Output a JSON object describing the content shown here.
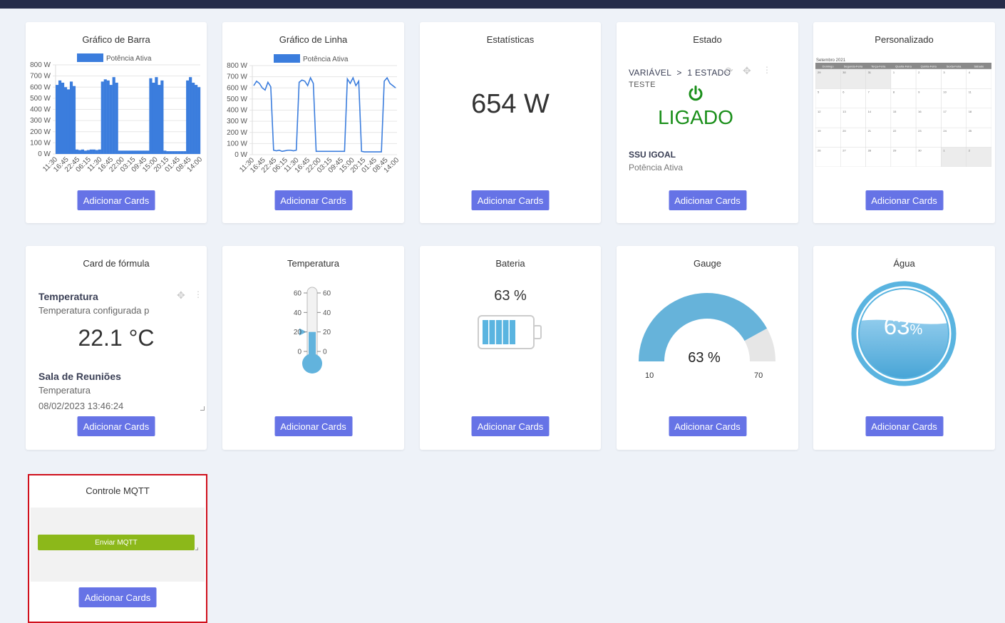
{
  "common": {
    "add_label": "Adicionar Cards"
  },
  "bar_card": {
    "title": "Gráfico de Barra",
    "chart_data": {
      "type": "bar",
      "legend": "Potência Ativa",
      "yticks": [
        "800 W",
        "700 W",
        "600 W",
        "500 W",
        "400 W",
        "300 W",
        "200 W",
        "100 W",
        "0 W"
      ],
      "xticks": [
        "11:30",
        "16:45",
        "22:45",
        "06:15",
        "11:30",
        "16:45",
        "22:00",
        "03:15",
        "09:45",
        "15:00",
        "20:15",
        "01:45",
        "08:45",
        "14:00"
      ],
      "ylim": [
        0,
        800
      ],
      "values": [
        620,
        660,
        640,
        600,
        580,
        650,
        610,
        40,
        35,
        40,
        30,
        35,
        40,
        40,
        35,
        40,
        650,
        670,
        660,
        620,
        690,
        640,
        30,
        30,
        30,
        30,
        30,
        30,
        30,
        30,
        30,
        30,
        30,
        680,
        640,
        690,
        620,
        660,
        30,
        25,
        25,
        25,
        25,
        25,
        25,
        25,
        660,
        690,
        640,
        620,
        600
      ]
    }
  },
  "line_card": {
    "title": "Gráfico de Linha",
    "chart_data": {
      "type": "line",
      "legend": "Potência Ativa",
      "yticks": [
        "800 W",
        "700 W",
        "600 W",
        "500 W",
        "400 W",
        "300 W",
        "200 W",
        "100 W",
        "0 W"
      ],
      "xticks": [
        "11:30",
        "16:45",
        "22:45",
        "06:15",
        "11:30",
        "16:45",
        "22:00",
        "03:15",
        "09:45",
        "15:00",
        "20:15",
        "01:45",
        "08:45",
        "14:00"
      ],
      "ylim": [
        0,
        800
      ],
      "values": [
        620,
        660,
        640,
        600,
        580,
        650,
        610,
        40,
        35,
        40,
        30,
        35,
        40,
        40,
        35,
        40,
        650,
        670,
        660,
        620,
        690,
        640,
        30,
        30,
        30,
        30,
        30,
        30,
        30,
        30,
        30,
        30,
        30,
        680,
        640,
        690,
        620,
        660,
        30,
        25,
        25,
        25,
        25,
        25,
        25,
        25,
        660,
        690,
        640,
        620,
        600
      ]
    }
  },
  "stats_card": {
    "title": "Estatísticas",
    "value": "654 W"
  },
  "estado_card": {
    "title": "Estado",
    "variable": "VARIÁVEL",
    "sep": ">",
    "state_name": "1 ESTADO",
    "tag": "TESTE",
    "state_value": "LIGADO",
    "device": "SSU IGOAL",
    "measure": "Potência Ativa",
    "state_color": "#1a8f1a"
  },
  "personalizado_card": {
    "title": "Personalizado",
    "calendar_title": "Setembro 2021",
    "weekdays": [
      "Domingo",
      "Segunda-Feira",
      "Terça-Feira",
      "Quarta-Feira",
      "Quinta-Feira",
      "Sexta-Feira",
      "Sábado"
    ],
    "weeks": [
      [
        "29",
        "30",
        "31",
        "1",
        "2",
        "3",
        "4"
      ],
      [
        "5",
        "6",
        "7",
        "8",
        "9",
        "10",
        "11"
      ],
      [
        "12",
        "13",
        "14",
        "15",
        "16",
        "17",
        "18"
      ],
      [
        "19",
        "20",
        "21",
        "22",
        "23",
        "24",
        "25"
      ],
      [
        "26",
        "27",
        "28",
        "29",
        "30",
        "1",
        "2"
      ]
    ]
  },
  "formula_card": {
    "title": "Card de fórmula",
    "name": "Temperatura",
    "desc": "Temperatura configurada p",
    "value": "22.1 °C",
    "place": "Sala de Reuniões",
    "measure": "Temperatura",
    "timestamp": "08/02/2023 13:46:24"
  },
  "temp_card": {
    "title": "Temperatura",
    "ticks": [
      "60",
      "40",
      "20",
      "0"
    ],
    "level": 20,
    "max": 60,
    "color": "#62b3dd"
  },
  "bateria_card": {
    "title": "Bateria",
    "value": "63 %",
    "level": 0.63,
    "color": "#5ab4e0"
  },
  "gauge_card": {
    "title": "Gauge",
    "value": "63 %",
    "min": "10",
    "max": "70",
    "level": 0.63,
    "color": "#66b3da"
  },
  "agua_card": {
    "title": "Água",
    "value": "63",
    "unit": "%",
    "level": 0.63,
    "color": "#5ab4e0"
  },
  "mqtt_card": {
    "title": "Controle MQTT",
    "button": "Enviar MQTT"
  }
}
